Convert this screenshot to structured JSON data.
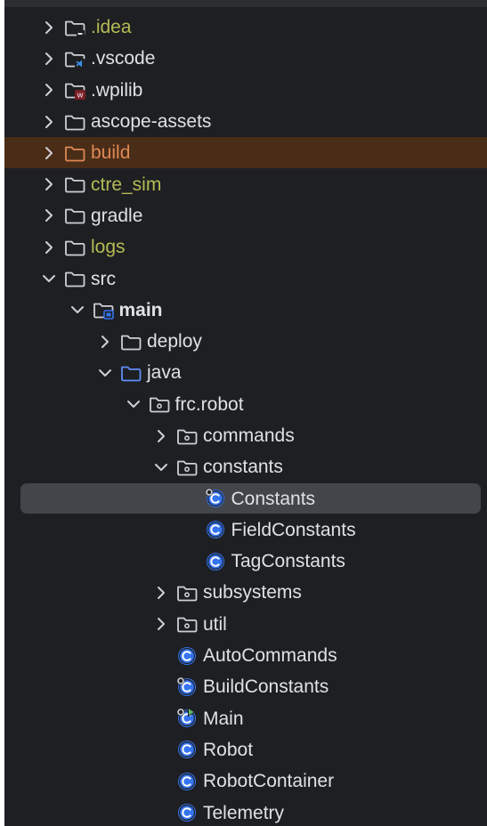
{
  "theme": {
    "text": "#dfe1e5",
    "excluded_text": "#b4bb54",
    "build_text": "#e08855",
    "build_row_bg": "#4a2d17",
    "selected_row_bg": "#43454a",
    "java_folder_color": "#5e8ef7",
    "class_icon_color": "#3574f0",
    "run_marker_color": "#5fb865"
  },
  "tree": [
    {
      "label": ".idea",
      "depth": 0,
      "arrow": "right",
      "icon": "folder-icon",
      "badge": "settings",
      "color": "#b4bb54"
    },
    {
      "label": ".vscode",
      "depth": 0,
      "arrow": "right",
      "icon": "folder-icon",
      "badge": "vscode",
      "color": "#dfe1e5"
    },
    {
      "label": ".wpilib",
      "depth": 0,
      "arrow": "right",
      "icon": "folder-icon",
      "badge": "wpilib",
      "color": "#dfe1e5"
    },
    {
      "label": "ascope-assets",
      "depth": 0,
      "arrow": "right",
      "icon": "folder-icon",
      "color": "#dfe1e5"
    },
    {
      "label": "build",
      "depth": 0,
      "arrow": "right",
      "icon": "folder-icon",
      "color": "#e08855",
      "highlight": true
    },
    {
      "label": "ctre_sim",
      "depth": 0,
      "arrow": "right",
      "icon": "folder-icon",
      "color": "#b4bb54"
    },
    {
      "label": "gradle",
      "depth": 0,
      "arrow": "right",
      "icon": "folder-icon",
      "color": "#dfe1e5"
    },
    {
      "label": "logs",
      "depth": 0,
      "arrow": "right",
      "icon": "folder-icon",
      "color": "#b4bb54"
    },
    {
      "label": "src",
      "depth": 0,
      "arrow": "down",
      "icon": "folder-icon",
      "color": "#dfe1e5"
    },
    {
      "label": "main",
      "depth": 1,
      "arrow": "down",
      "icon": "folder-icon",
      "badge": "module",
      "color": "#dfe1e5",
      "bold": true
    },
    {
      "label": "deploy",
      "depth": 2,
      "arrow": "right",
      "icon": "folder-icon",
      "color": "#dfe1e5"
    },
    {
      "label": "java",
      "depth": 2,
      "arrow": "down",
      "icon": "source-folder-icon",
      "color": "#dfe1e5"
    },
    {
      "label": "frc.robot",
      "depth": 3,
      "arrow": "down",
      "icon": "package-icon",
      "color": "#dfe1e5"
    },
    {
      "label": "commands",
      "depth": 4,
      "arrow": "right",
      "icon": "package-icon",
      "color": "#dfe1e5"
    },
    {
      "label": "constants",
      "depth": 4,
      "arrow": "down",
      "icon": "package-icon",
      "color": "#dfe1e5"
    },
    {
      "label": "Constants",
      "depth": 5,
      "icon": "class-icon",
      "badge": "final",
      "color": "#dfe1e5",
      "selected": true
    },
    {
      "label": "FieldConstants",
      "depth": 5,
      "icon": "class-icon",
      "color": "#dfe1e5"
    },
    {
      "label": "TagConstants",
      "depth": 5,
      "icon": "class-icon",
      "color": "#dfe1e5"
    },
    {
      "label": "subsystems",
      "depth": 4,
      "arrow": "right",
      "icon": "package-icon",
      "color": "#dfe1e5"
    },
    {
      "label": "util",
      "depth": 4,
      "arrow": "right",
      "icon": "package-icon",
      "color": "#dfe1e5"
    },
    {
      "label": "AutoCommands",
      "depth": 4,
      "icon": "class-icon",
      "color": "#dfe1e5"
    },
    {
      "label": "BuildConstants",
      "depth": 4,
      "icon": "class-icon",
      "badge": "final",
      "color": "#dfe1e5"
    },
    {
      "label": "Main",
      "depth": 4,
      "icon": "class-icon",
      "badge": "final-run",
      "color": "#dfe1e5"
    },
    {
      "label": "Robot",
      "depth": 4,
      "icon": "class-icon",
      "color": "#dfe1e5"
    },
    {
      "label": "RobotContainer",
      "depth": 4,
      "icon": "class-icon",
      "color": "#dfe1e5"
    },
    {
      "label": "Telemetry",
      "depth": 4,
      "icon": "class-icon",
      "color": "#dfe1e5"
    }
  ]
}
